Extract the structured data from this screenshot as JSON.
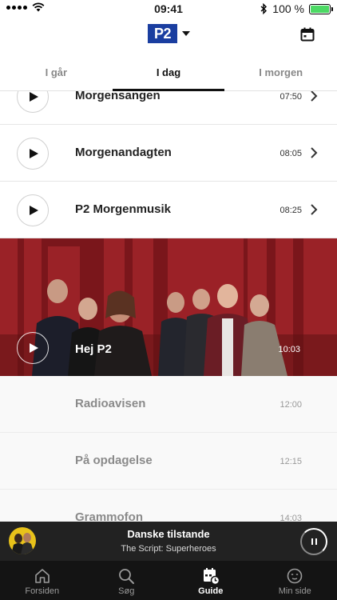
{
  "status_bar": {
    "time": "09:41",
    "battery": "100 %"
  },
  "header": {
    "logo": "P2"
  },
  "tabs": [
    {
      "label": "I går"
    },
    {
      "label": "I dag"
    },
    {
      "label": "I morgen"
    }
  ],
  "programs": [
    {
      "title": "Morgensangen",
      "time": "07:50"
    },
    {
      "title": "Morgenandagten",
      "time": "08:05"
    },
    {
      "title": "P2 Morgenmusik",
      "time": "08:25"
    }
  ],
  "featured": {
    "title": "Hej P2",
    "time": "10:03"
  },
  "upcoming": [
    {
      "title": "Radioavisen",
      "time": "12:00"
    },
    {
      "title": "På opdagelse",
      "time": "12:15"
    },
    {
      "title": "Grammofon",
      "time": "14:03"
    }
  ],
  "player": {
    "title": "Danske tilstande",
    "subtitle": "The Script: Superheroes"
  },
  "nav": [
    {
      "label": "Forsiden",
      "icon": "home-icon"
    },
    {
      "label": "Søg",
      "icon": "search-icon"
    },
    {
      "label": "Guide",
      "icon": "guide-calendar-icon"
    },
    {
      "label": "Min side",
      "icon": "profile-icon"
    }
  ]
}
